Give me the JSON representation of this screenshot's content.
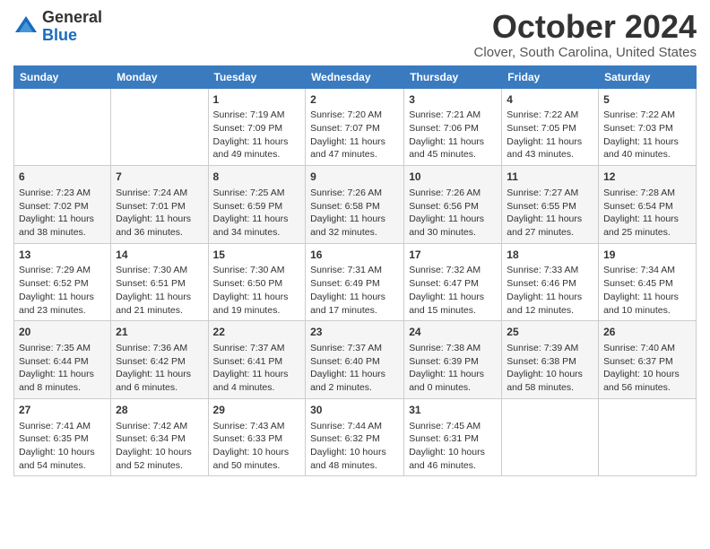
{
  "logo": {
    "general": "General",
    "blue": "Blue"
  },
  "header": {
    "month": "October 2024",
    "location": "Clover, South Carolina, United States"
  },
  "days_of_week": [
    "Sunday",
    "Monday",
    "Tuesday",
    "Wednesday",
    "Thursday",
    "Friday",
    "Saturday"
  ],
  "weeks": [
    [
      {
        "day": "",
        "info": ""
      },
      {
        "day": "",
        "info": ""
      },
      {
        "day": "1",
        "info": "Sunrise: 7:19 AM\nSunset: 7:09 PM\nDaylight: 11 hours and 49 minutes."
      },
      {
        "day": "2",
        "info": "Sunrise: 7:20 AM\nSunset: 7:07 PM\nDaylight: 11 hours and 47 minutes."
      },
      {
        "day": "3",
        "info": "Sunrise: 7:21 AM\nSunset: 7:06 PM\nDaylight: 11 hours and 45 minutes."
      },
      {
        "day": "4",
        "info": "Sunrise: 7:22 AM\nSunset: 7:05 PM\nDaylight: 11 hours and 43 minutes."
      },
      {
        "day": "5",
        "info": "Sunrise: 7:22 AM\nSunset: 7:03 PM\nDaylight: 11 hours and 40 minutes."
      }
    ],
    [
      {
        "day": "6",
        "info": "Sunrise: 7:23 AM\nSunset: 7:02 PM\nDaylight: 11 hours and 38 minutes."
      },
      {
        "day": "7",
        "info": "Sunrise: 7:24 AM\nSunset: 7:01 PM\nDaylight: 11 hours and 36 minutes."
      },
      {
        "day": "8",
        "info": "Sunrise: 7:25 AM\nSunset: 6:59 PM\nDaylight: 11 hours and 34 minutes."
      },
      {
        "day": "9",
        "info": "Sunrise: 7:26 AM\nSunset: 6:58 PM\nDaylight: 11 hours and 32 minutes."
      },
      {
        "day": "10",
        "info": "Sunrise: 7:26 AM\nSunset: 6:56 PM\nDaylight: 11 hours and 30 minutes."
      },
      {
        "day": "11",
        "info": "Sunrise: 7:27 AM\nSunset: 6:55 PM\nDaylight: 11 hours and 27 minutes."
      },
      {
        "day": "12",
        "info": "Sunrise: 7:28 AM\nSunset: 6:54 PM\nDaylight: 11 hours and 25 minutes."
      }
    ],
    [
      {
        "day": "13",
        "info": "Sunrise: 7:29 AM\nSunset: 6:52 PM\nDaylight: 11 hours and 23 minutes."
      },
      {
        "day": "14",
        "info": "Sunrise: 7:30 AM\nSunset: 6:51 PM\nDaylight: 11 hours and 21 minutes."
      },
      {
        "day": "15",
        "info": "Sunrise: 7:30 AM\nSunset: 6:50 PM\nDaylight: 11 hours and 19 minutes."
      },
      {
        "day": "16",
        "info": "Sunrise: 7:31 AM\nSunset: 6:49 PM\nDaylight: 11 hours and 17 minutes."
      },
      {
        "day": "17",
        "info": "Sunrise: 7:32 AM\nSunset: 6:47 PM\nDaylight: 11 hours and 15 minutes."
      },
      {
        "day": "18",
        "info": "Sunrise: 7:33 AM\nSunset: 6:46 PM\nDaylight: 11 hours and 12 minutes."
      },
      {
        "day": "19",
        "info": "Sunrise: 7:34 AM\nSunset: 6:45 PM\nDaylight: 11 hours and 10 minutes."
      }
    ],
    [
      {
        "day": "20",
        "info": "Sunrise: 7:35 AM\nSunset: 6:44 PM\nDaylight: 11 hours and 8 minutes."
      },
      {
        "day": "21",
        "info": "Sunrise: 7:36 AM\nSunset: 6:42 PM\nDaylight: 11 hours and 6 minutes."
      },
      {
        "day": "22",
        "info": "Sunrise: 7:37 AM\nSunset: 6:41 PM\nDaylight: 11 hours and 4 minutes."
      },
      {
        "day": "23",
        "info": "Sunrise: 7:37 AM\nSunset: 6:40 PM\nDaylight: 11 hours and 2 minutes."
      },
      {
        "day": "24",
        "info": "Sunrise: 7:38 AM\nSunset: 6:39 PM\nDaylight: 11 hours and 0 minutes."
      },
      {
        "day": "25",
        "info": "Sunrise: 7:39 AM\nSunset: 6:38 PM\nDaylight: 10 hours and 58 minutes."
      },
      {
        "day": "26",
        "info": "Sunrise: 7:40 AM\nSunset: 6:37 PM\nDaylight: 10 hours and 56 minutes."
      }
    ],
    [
      {
        "day": "27",
        "info": "Sunrise: 7:41 AM\nSunset: 6:35 PM\nDaylight: 10 hours and 54 minutes."
      },
      {
        "day": "28",
        "info": "Sunrise: 7:42 AM\nSunset: 6:34 PM\nDaylight: 10 hours and 52 minutes."
      },
      {
        "day": "29",
        "info": "Sunrise: 7:43 AM\nSunset: 6:33 PM\nDaylight: 10 hours and 50 minutes."
      },
      {
        "day": "30",
        "info": "Sunrise: 7:44 AM\nSunset: 6:32 PM\nDaylight: 10 hours and 48 minutes."
      },
      {
        "day": "31",
        "info": "Sunrise: 7:45 AM\nSunset: 6:31 PM\nDaylight: 10 hours and 46 minutes."
      },
      {
        "day": "",
        "info": ""
      },
      {
        "day": "",
        "info": ""
      }
    ]
  ]
}
